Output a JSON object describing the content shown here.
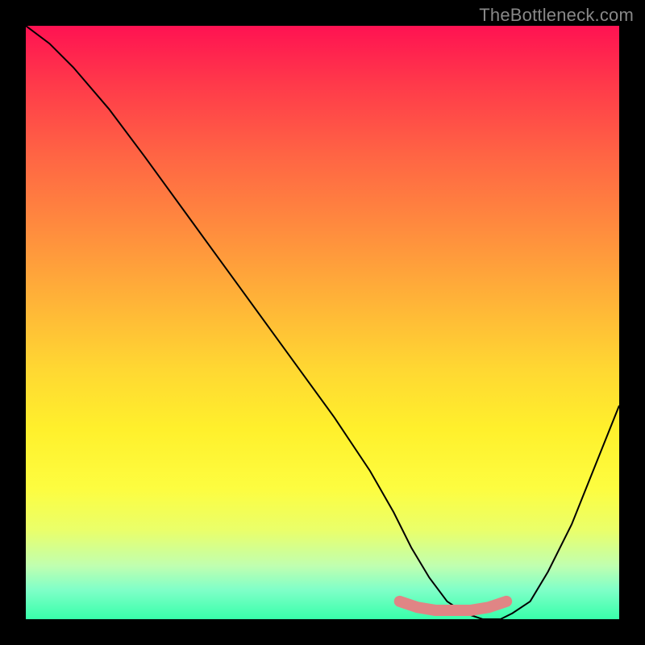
{
  "watermark": "TheBottleneck.com",
  "chart_data": {
    "type": "line",
    "title": "",
    "xlabel": "",
    "ylabel": "",
    "xlim": [
      0,
      100
    ],
    "ylim": [
      0,
      100
    ],
    "gradient_colors": {
      "top": "#ff1252",
      "bottom": "#38ffaa"
    },
    "series": [
      {
        "name": "bottleneck-curve",
        "color": "#000000",
        "x": [
          0,
          4,
          8,
          14,
          20,
          28,
          36,
          44,
          52,
          58,
          62,
          65,
          68,
          71,
          74,
          77,
          80,
          82,
          85,
          88,
          92,
          96,
          100
        ],
        "values": [
          100,
          97,
          93,
          86,
          78,
          67,
          56,
          45,
          34,
          25,
          18,
          12,
          7,
          3,
          1,
          0,
          0,
          1,
          3,
          8,
          16,
          26,
          36
        ]
      },
      {
        "name": "highlight-band",
        "color": "#e08585",
        "x": [
          63,
          66,
          69,
          72,
          75,
          78,
          81
        ],
        "values": [
          3,
          2,
          1.5,
          1.5,
          1.5,
          2,
          3
        ]
      }
    ],
    "optimal_region": {
      "x_start": 63,
      "x_end": 81
    }
  }
}
